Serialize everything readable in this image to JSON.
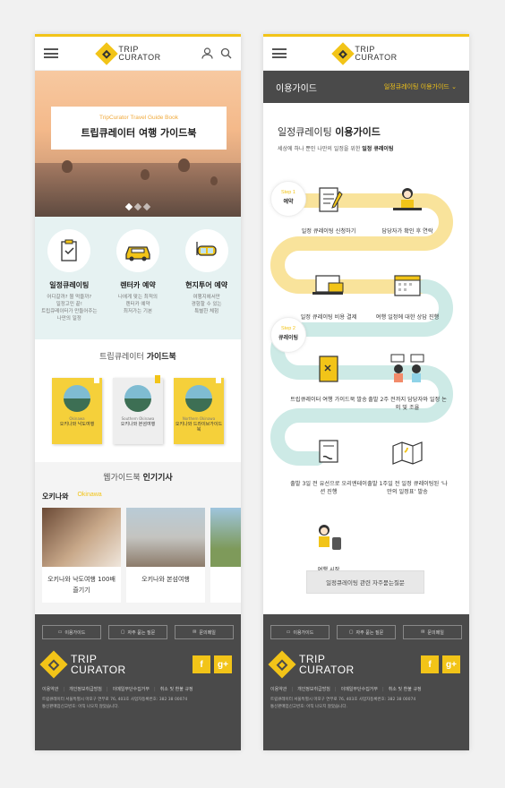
{
  "brand": {
    "line1": "TRIP",
    "line2": "CURATOR",
    "accent": "#f2c418",
    "dark": "#4a4a4a"
  },
  "left": {
    "hero": {
      "subtitle": "TripCurator Travel Guide Book",
      "title": "트립큐레이터 여행 가이드북"
    },
    "services": [
      {
        "icon": "clipboard-check-icon",
        "title": "일정큐레이팅",
        "desc": [
          "어디갈까? 뭘 먹을까?",
          "일정고민 끝!",
          "트립큐레이터가 만들어주는",
          "나만의 일정"
        ]
      },
      {
        "icon": "car-icon",
        "title": "렌터카 예약",
        "desc": [
          "나에게 맞는 최적의",
          "렌터카 예약",
          "최저가는 기본"
        ]
      },
      {
        "icon": "snorkel-icon",
        "title": "현지투어 예약",
        "desc": [
          "여행지에서만",
          "경험할 수 있는",
          "특별한 체험"
        ]
      }
    ],
    "guidebook": {
      "prefix": "트립큐레이터 ",
      "bold": "가이드북",
      "books": [
        {
          "en": "Okinawa",
          "ko": "오키나와 낙도여행"
        },
        {
          "en": "Southern Okinawa",
          "ko": "오키나와 본섬여행"
        },
        {
          "en": "Northern Okinawa",
          "ko": "오키나와 드라이브가이드북"
        }
      ]
    },
    "popular": {
      "prefix": "웹가이드북 ",
      "bold": "인기기사",
      "tab_ko": "오키나와",
      "tab_en": "Okinawa",
      "cards": [
        {
          "title": "오키나와 낙도여행 100배 즐기기"
        },
        {
          "title": "오키나와 본섬여행"
        },
        {
          "title": "오키"
        }
      ]
    }
  },
  "right": {
    "bar": {
      "title": "이용가이드",
      "selector": "일정큐레이팅 이용가이드"
    },
    "heading": {
      "light": "일정큐레이팅 ",
      "bold": "이용가이드",
      "desc": "세상에 하나 뿐인 나만의 일정을 위한 ",
      "desc_bold": "일정 큐레이팅"
    },
    "steps": [
      {
        "num": "Step 1",
        "label": "예약"
      },
      {
        "num": "Step 2",
        "label": "큐레이팅"
      }
    ],
    "nodes": [
      {
        "text": "일정 큐레이팅 신청하기"
      },
      {
        "text": "담당자가 확인 후 연락"
      },
      {
        "text": "일정 큐레이팅 비용 결제"
      },
      {
        "text": "여행 일정에 대한 상담 진행"
      },
      {
        "text": "트립큐레이터 여행 가이드북 발송"
      },
      {
        "text": "출발 2주 전까지 담당자와 일정 논의 및 조율"
      },
      {
        "text": "출발 3일 전 유선으로 오리엔테이션 진행"
      },
      {
        "text": "출발 1주일 전 일정 큐레이팅된 ‘나만의 일정표’ 발송"
      },
      {
        "text": "여행 시작"
      }
    ],
    "faq": "일정큐레이팅 관련 자주묻는질문"
  },
  "footer": {
    "buttons": [
      "이용가이드",
      "자주 묻는 질문",
      "문의메일"
    ],
    "social": [
      "f",
      "g+"
    ],
    "links": [
      "이용약관",
      "개인정보취급방침",
      "이메일무단수집거부",
      "취소 및 환불 규정"
    ],
    "info1": "트립큐레이터 서울특별시 마포구 연무로 76, 403호 사업자등록번호: 382 38 00074",
    "info2": "통신판매업신고번호: 아직 나오지 않았습니다."
  }
}
